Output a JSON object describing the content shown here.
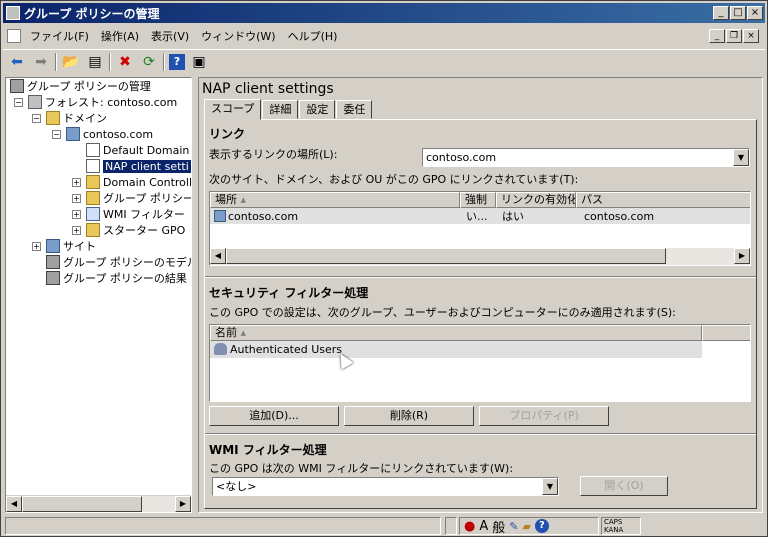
{
  "window": {
    "title": "グループ ポリシーの管理"
  },
  "menu": [
    "ファイル(F)",
    "操作(A)",
    "表示(V)",
    "ウィンドウ(W)",
    "ヘルプ(H)"
  ],
  "tree": {
    "root": "グループ ポリシーの管理",
    "forest": "フォレスト: contoso.com",
    "domains": "ドメイン",
    "domain": "contoso.com",
    "default_domain": "Default Domain",
    "nap_client": "NAP client setti",
    "domain_controllers": "Domain Controlle",
    "gpo": "グループ ポリシー",
    "wmi_filters": "WMI フィルター",
    "starter_gpo": "スターター GPO",
    "sites": "サイト",
    "modeling": "グループ ポリシーのモデル(",
    "results": "グループ ポリシーの結果"
  },
  "right": {
    "title": "NAP client settings",
    "tabs": [
      "スコープ",
      "詳細",
      "設定",
      "委任"
    ],
    "links": {
      "heading": "リンク",
      "location_label": "表示するリンクの場所(L):",
      "location_value": "contoso.com",
      "description": "次のサイト、ドメイン、および OU がこの GPO にリンクされています(T):",
      "columns": [
        "場所",
        "強制",
        "リンクの有効化",
        "パス"
      ],
      "rows": [
        {
          "location": "contoso.com",
          "enforced": "い...",
          "enabled": "はい",
          "path": "contoso.com"
        }
      ]
    },
    "security": {
      "heading": "セキュリティ フィルター処理",
      "description": "この GPO での設定は、次のグループ、ユーザーおよびコンピューターにのみ適用されます(S):",
      "columns": [
        "名前"
      ],
      "rows": [
        "Authenticated Users"
      ],
      "add_button": "追加(D)...",
      "remove_button": "削除(R)",
      "properties_button": "プロパティ(P)"
    },
    "wmi": {
      "heading": "WMI フィルター処理",
      "description": "この GPO は次の WMI フィルターにリンクされています(W):",
      "value": "<なし>",
      "open_button": "開く(O)"
    }
  },
  "statusbar": {
    "ime_a": "A",
    "ime_kan": "般",
    "caps": "CAPS",
    "kana": "KANA"
  }
}
